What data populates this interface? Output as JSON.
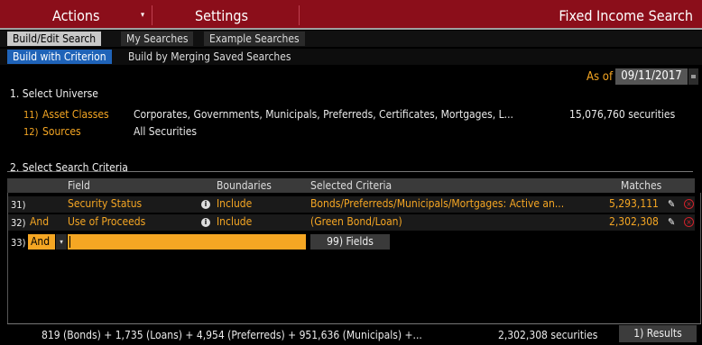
{
  "menu": {
    "actions_label": "Actions",
    "actions_caret": "▾",
    "settings_label": "Settings",
    "title": "Fixed Income Search"
  },
  "tabs": [
    {
      "label": "Build/Edit Search",
      "active": true
    },
    {
      "label": "My Searches",
      "active": false
    },
    {
      "label": "Example Searches",
      "active": false
    }
  ],
  "subtabs": [
    {
      "label": "Build with Criterion",
      "active": true
    },
    {
      "label": "Build by Merging Saved Searches",
      "active": false
    }
  ],
  "as_of": {
    "label": "As of",
    "date": "09/11/2017"
  },
  "universe": {
    "heading": "1. Select Universe",
    "rows": [
      {
        "num": "11)",
        "label": "Asset Classes",
        "value": "Corporates, Governments, Municipals, Preferreds, Certificates, Mortgages, L...",
        "count": "15,076,760 securities"
      },
      {
        "num": "12)",
        "label": "Sources",
        "value": "All Securities"
      }
    ]
  },
  "criteria": {
    "heading": "2. Select Search Criteria",
    "columns": {
      "field": "Field",
      "boundaries": "Boundaries",
      "selected": "Selected Criteria",
      "matches": "Matches"
    },
    "rows": [
      {
        "num": "31)",
        "conj": "",
        "field": "Security Status",
        "boundary": "Include",
        "selected": "Bonds/Preferreds/Municipals/Mortgages: Active an...",
        "matches": "5,293,111"
      },
      {
        "num": "32)",
        "conj": "And",
        "field": "Use of Proceeds",
        "boundary": "Include",
        "selected": "(Green Bond/Loan)",
        "matches": "2,302,308"
      }
    ],
    "new_row": {
      "num": "33)",
      "conj": "And",
      "dropdown": "▾",
      "fields_button": "99) Fields"
    }
  },
  "footer": {
    "summary": "819 (Bonds) + 1,735 (Loans) + 4,954 (Preferreds) + 951,636 (Municipals) +...",
    "count": "2,302,308 securities",
    "results_button": "1) Results"
  },
  "icons": {
    "info": "info-icon",
    "edit": "pencil-icon",
    "remove": "close-circle-icon"
  },
  "colors": {
    "menu_bar": "#8b0e1a",
    "accent": "#f5a623",
    "active_subtab": "#1f63b8",
    "remove": "#d0212a"
  }
}
